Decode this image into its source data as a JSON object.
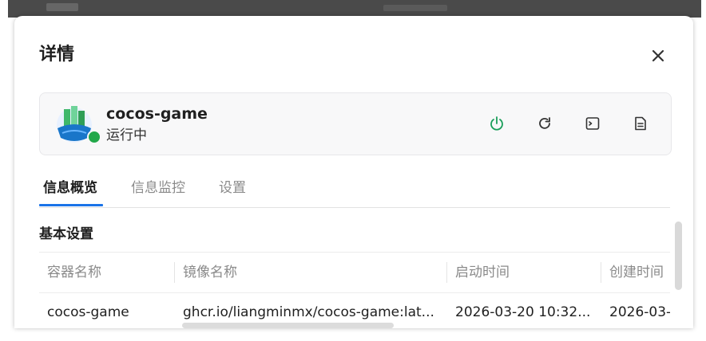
{
  "dialog": {
    "title": "详情",
    "close_icon": "close-icon"
  },
  "app": {
    "name": "cocos-game",
    "status": "运行中",
    "status_color": "#22a84a",
    "actions": [
      {
        "icon": "power-icon",
        "color": "#1a9e5a"
      },
      {
        "icon": "refresh-icon",
        "color": "#333333"
      },
      {
        "icon": "terminal-icon",
        "color": "#333333"
      },
      {
        "icon": "log-document-icon",
        "color": "#333333"
      }
    ]
  },
  "tabs": [
    {
      "label": "信息概览",
      "active": true
    },
    {
      "label": "信息监控",
      "active": false
    },
    {
      "label": "设置",
      "active": false
    }
  ],
  "accent_color": "#1a73e8",
  "section": {
    "title": "基本设置"
  },
  "table": {
    "headers": [
      "容器名称",
      "镜像名称",
      "启动时间",
      "创建时间"
    ],
    "rows": [
      [
        "cocos-game",
        "ghcr.io/liangminmx/cocos-game:lat...",
        "2026-03-20 10:32...",
        "2026-03-"
      ]
    ]
  }
}
